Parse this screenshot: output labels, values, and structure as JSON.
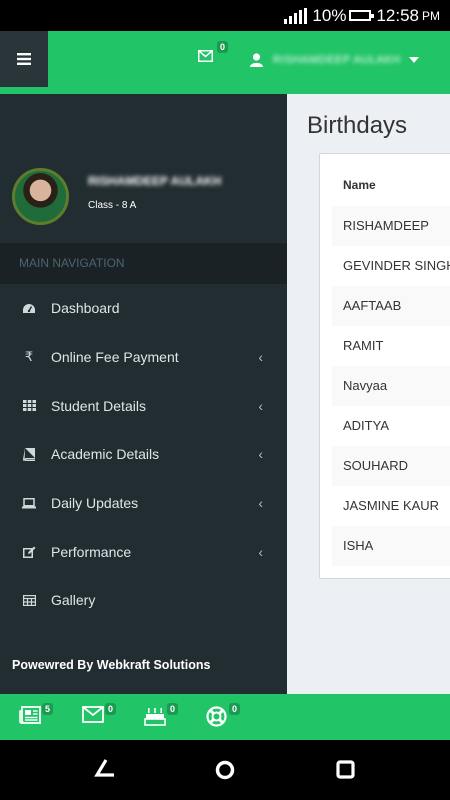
{
  "status_bar": {
    "battery": "10%",
    "time": "12:58",
    "ampm": "PM"
  },
  "header": {
    "mail_count": "0",
    "user_name": "RISHAMDEEP AULAKH"
  },
  "sidebar": {
    "user_name": "RISHAMDEEP AULAKH",
    "user_class": "Class - 8 A",
    "nav_header": "MAIN NAVIGATION",
    "items": [
      {
        "label": "Dashboard",
        "icon": "dashboard-icon",
        "expandable": false
      },
      {
        "label": "Online Fee Payment",
        "icon": "rupee-icon",
        "expandable": true
      },
      {
        "label": "Student Details",
        "icon": "grid-icon",
        "expandable": true
      },
      {
        "label": "Academic Details",
        "icon": "book-icon",
        "expandable": true
      },
      {
        "label": "Daily Updates",
        "icon": "laptop-icon",
        "expandable": true
      },
      {
        "label": "Performance",
        "icon": "edit-icon",
        "expandable": true
      },
      {
        "label": "Gallery",
        "icon": "table-icon",
        "expandable": false
      }
    ],
    "footer": "Powewred By Webkraft Solutions"
  },
  "content": {
    "title": "Birthdays",
    "column_header": "Name",
    "names": [
      "RISHAMDEEP",
      "GEVINDER SINGH",
      "AAFTAAB",
      "RAMIT",
      "Navyaa",
      "ADITYA",
      "SOUHARD",
      "JASMINE KAUR",
      "ISHA"
    ]
  },
  "footer_bar": {
    "news_count": "5",
    "mail_count": "0",
    "birthday_count": "0",
    "support_count": "0"
  },
  "colors": {
    "brand_green": "#22c468",
    "sidebar_bg": "#222d32",
    "content_bg": "#ecf0f5"
  }
}
